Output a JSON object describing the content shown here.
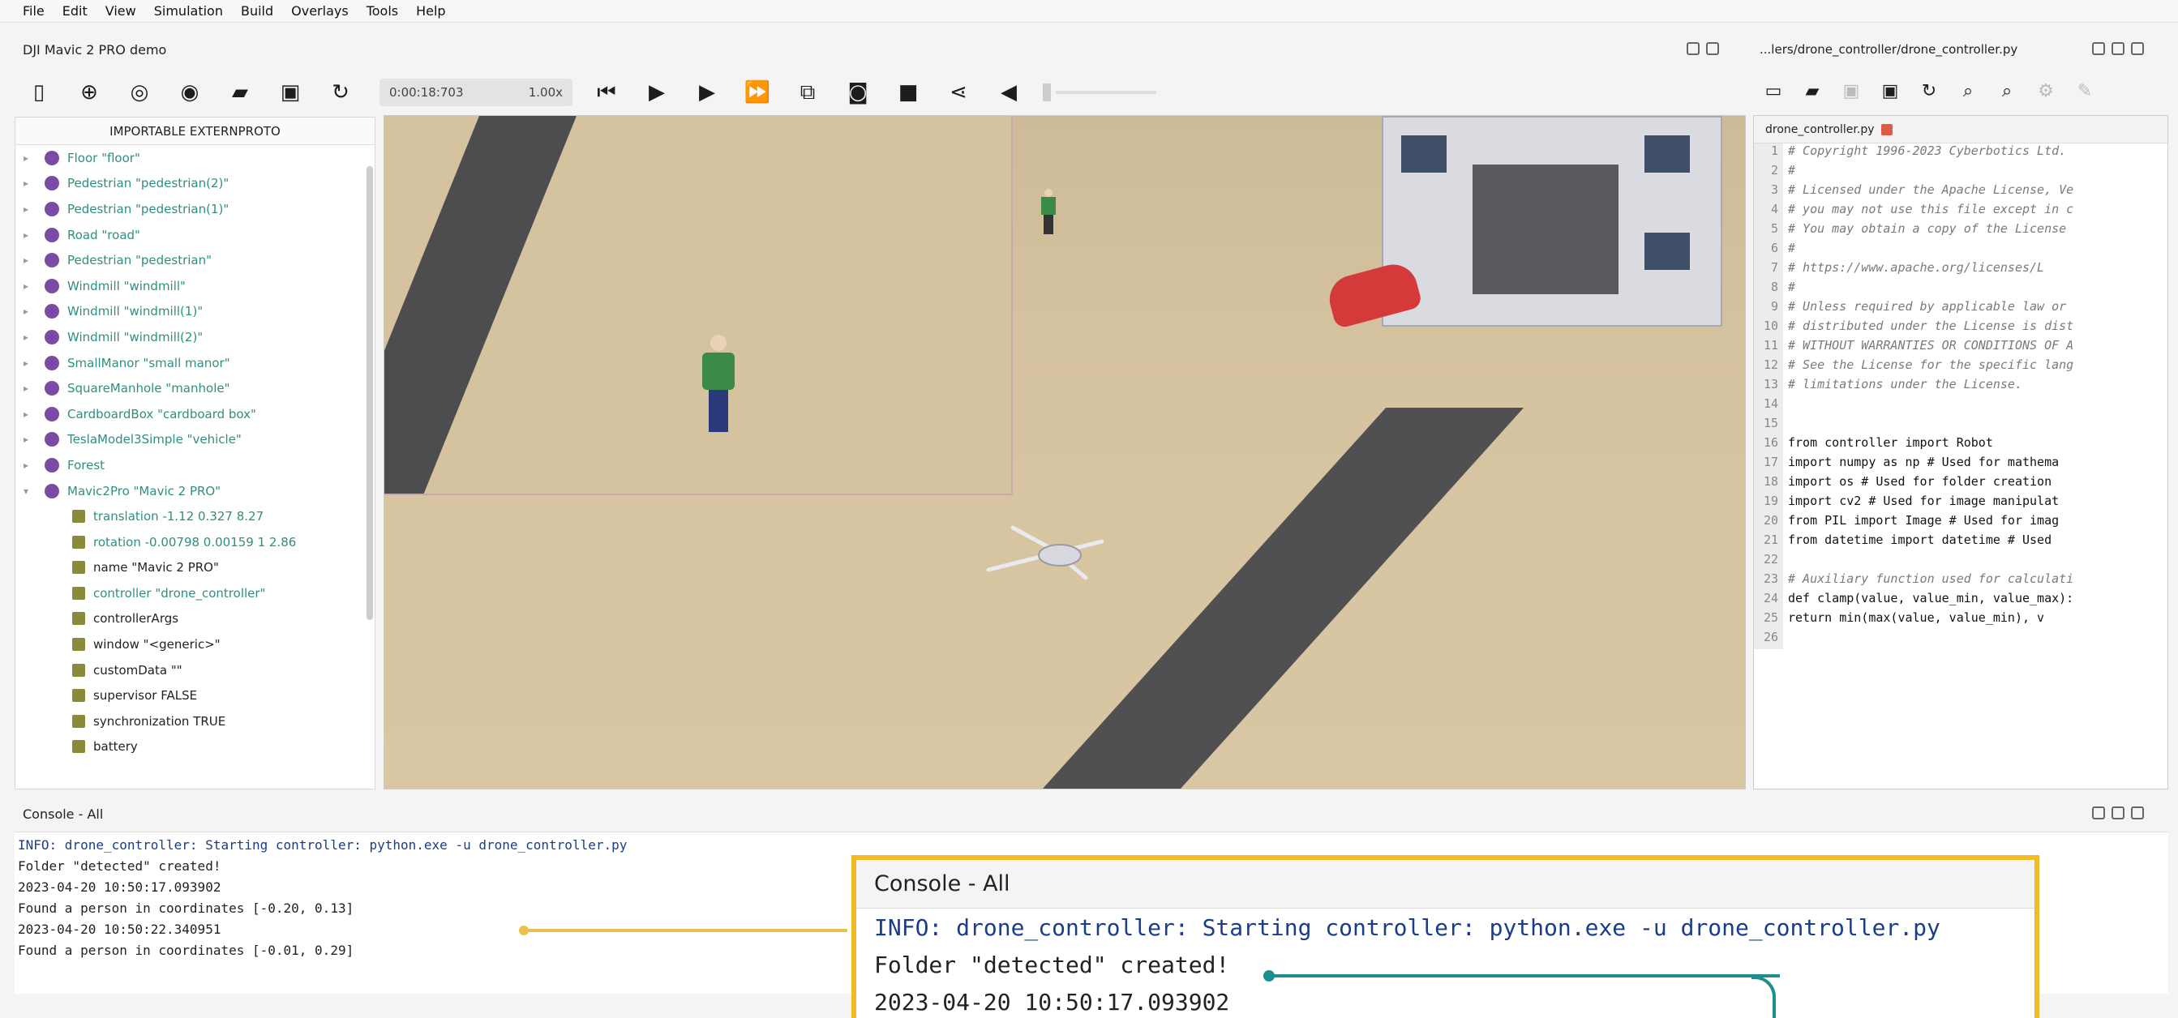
{
  "menu": [
    "File",
    "Edit",
    "View",
    "Simulation",
    "Build",
    "Overlays",
    "Tools",
    "Help"
  ],
  "window": {
    "title": "DJI Mavic 2 PRO demo"
  },
  "toolbar": {
    "time": "0:00:18:703",
    "speed": "1.00x"
  },
  "scene_tree": {
    "header": "IMPORTABLE EXTERNPROTO",
    "items": [
      {
        "label": "Floor \"floor\"",
        "kind": "node"
      },
      {
        "label": "Pedestrian \"pedestrian(2)\"",
        "kind": "node"
      },
      {
        "label": "Pedestrian \"pedestrian(1)\"",
        "kind": "node"
      },
      {
        "label": "Road \"road\"",
        "kind": "node"
      },
      {
        "label": "Pedestrian \"pedestrian\"",
        "kind": "node"
      },
      {
        "label": "Windmill \"windmill\"",
        "kind": "node"
      },
      {
        "label": "Windmill \"windmill(1)\"",
        "kind": "node"
      },
      {
        "label": "Windmill \"windmill(2)\"",
        "kind": "node"
      },
      {
        "label": "SmallManor \"small manor\"",
        "kind": "node"
      },
      {
        "label": "SquareManhole \"manhole\"",
        "kind": "node"
      },
      {
        "label": "CardboardBox \"cardboard box\"",
        "kind": "node"
      },
      {
        "label": "TeslaModel3Simple \"vehicle\"",
        "kind": "node"
      },
      {
        "label": "Forest",
        "kind": "node"
      },
      {
        "label": "Mavic2Pro \"Mavic 2 PRO\"",
        "kind": "node"
      },
      {
        "label": "translation -1.12 0.327 8.27",
        "kind": "fieldval"
      },
      {
        "label": "rotation -0.00798 0.00159 1 2.86",
        "kind": "fieldval"
      },
      {
        "label": "name \"Mavic 2 PRO\"",
        "kind": "field"
      },
      {
        "label": "controller \"drone_controller\"",
        "kind": "fieldval"
      },
      {
        "label": "controllerArgs",
        "kind": "field"
      },
      {
        "label": "window \"<generic>\"",
        "kind": "field"
      },
      {
        "label": "customData \"\"",
        "kind": "field"
      },
      {
        "label": "supervisor FALSE",
        "kind": "field"
      },
      {
        "label": "synchronization TRUE",
        "kind": "field"
      },
      {
        "label": "battery",
        "kind": "field"
      }
    ]
  },
  "editor": {
    "title": "...lers/drone_controller/drone_controller.py",
    "tab": "drone_controller.py",
    "lines": [
      {
        "n": "1",
        "text": "# Copyright 1996-2023 Cyberbotics Ltd.",
        "comment": true
      },
      {
        "n": "2",
        "text": "#",
        "comment": true
      },
      {
        "n": "3",
        "text": "# Licensed under the Apache License, Ve",
        "comment": true
      },
      {
        "n": "4",
        "text": "# you may not use this file except in c",
        "comment": true
      },
      {
        "n": "5",
        "text": "# You may obtain a copy of the License",
        "comment": true
      },
      {
        "n": "6",
        "text": "#",
        "comment": true
      },
      {
        "n": "7",
        "text": "#     https://www.apache.org/licenses/L",
        "comment": true
      },
      {
        "n": "8",
        "text": "#",
        "comment": true
      },
      {
        "n": "9",
        "text": "# Unless required by applicable law or",
        "comment": true
      },
      {
        "n": "10",
        "text": "# distributed under the License is dist",
        "comment": true
      },
      {
        "n": "11",
        "text": "# WITHOUT WARRANTIES OR CONDITIONS OF A",
        "comment": true
      },
      {
        "n": "12",
        "text": "# See the License for the specific lang",
        "comment": true
      },
      {
        "n": "13",
        "text": "# limitations under the License.",
        "comment": true
      },
      {
        "n": "14",
        "text": "",
        "comment": false
      },
      {
        "n": "15",
        "text": "",
        "comment": false
      },
      {
        "n": "16",
        "text": "from controller import Robot",
        "comment": false
      },
      {
        "n": "17",
        "text": "import numpy as np   # Used for mathema",
        "comment": false
      },
      {
        "n": "18",
        "text": "import os   # Used for folder creation",
        "comment": false
      },
      {
        "n": "19",
        "text": "import cv2   # Used for image manipulat",
        "comment": false
      },
      {
        "n": "20",
        "text": "from PIL import Image   # Used for imag",
        "comment": false
      },
      {
        "n": "21",
        "text": "from datetime import datetime   # Used",
        "comment": false
      },
      {
        "n": "22",
        "text": "",
        "comment": false
      },
      {
        "n": "23",
        "text": "# Auxiliary function used for calculati",
        "comment": true
      },
      {
        "n": "24",
        "text": "def clamp(value, value_min, value_max):",
        "comment": false
      },
      {
        "n": "25",
        "text": "    return min(max(value, value_min), v",
        "comment": false
      },
      {
        "n": "26",
        "text": "",
        "comment": false
      }
    ]
  },
  "console": {
    "title": "Console - All",
    "lines": [
      {
        "text": "INFO: drone_controller: Starting controller: python.exe -u drone_controller.py",
        "info": true
      },
      {
        "text": "Folder \"detected\" created!",
        "info": false
      },
      {
        "text": "2023-04-20 10:50:17.093902",
        "info": false
      },
      {
        "text": "Found a person in coordinates [-0.20, 0.13]",
        "info": false
      },
      {
        "text": "2023-04-20 10:50:22.340951",
        "info": false
      },
      {
        "text": "Found a person in coordinates [-0.01, 0.29]",
        "info": false
      }
    ]
  },
  "zoom": {
    "title": "Console - All",
    "lines": [
      {
        "text": "INFO: drone_controller: Starting controller: python.exe -u drone_controller.py",
        "info": true
      },
      {
        "text": "Folder \"detected\" created!",
        "info": false
      },
      {
        "text": "2023-04-20 10:50:17.093902",
        "info": false
      }
    ]
  },
  "colors": {
    "callout": "#f2bb24",
    "annotation": "#1e8f8f",
    "node": "#7a4aa5",
    "field": "#2f8f7f"
  },
  "icons": [
    "scene-tree-toggle-icon",
    "add-node-icon",
    "physics-icon",
    "eye-icon",
    "open-world-icon",
    "save-world-icon",
    "reload-world-icon",
    "reset-icon",
    "step-icon",
    "play-icon",
    "fast-forward-icon",
    "layout-icon",
    "screenshot-icon",
    "record-icon",
    "share-icon",
    "sound-icon"
  ]
}
